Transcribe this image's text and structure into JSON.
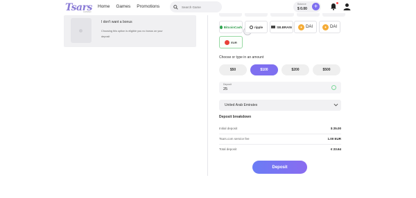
{
  "header": {
    "logo": "Tsars",
    "logo_sub": "CASINO",
    "nav": [
      "Home",
      "Games",
      "Promotions"
    ],
    "search_placeholder": "Search Game",
    "balance_label": "Balance",
    "balance_value": "$ 0.00"
  },
  "bonus": {
    "title": "I don't want a bonus",
    "description": "Choosing this option is eligible you no bonus on your deposit"
  },
  "payment_methods": [
    {
      "label": "BitcoinCash",
      "icon": "bitcoin-cash-icon"
    },
    {
      "label": "ripple",
      "icon": "ripple-icon"
    },
    {
      "label": "SB.BRAIN",
      "icon": "sb-icon"
    },
    {
      "label": "DAI",
      "icon": "dai-icon"
    },
    {
      "label": "DAI",
      "icon": "dai-icon"
    },
    {
      "label": "EUR",
      "icon": "eur-icon"
    }
  ],
  "amount": {
    "title": "Choose or type in an amount",
    "options": [
      "$50",
      "$100",
      "$200",
      "$500"
    ],
    "selected": "$100"
  },
  "deposit_input": {
    "label": "Deposit",
    "value": "25"
  },
  "country": {
    "value": "United Arab Emirates"
  },
  "breakdown": {
    "title": "Deposit breakdown",
    "rows": [
      {
        "label": "Initial deposit",
        "value": "$ 25.00"
      },
      {
        "label": "Tsars.com service fee",
        "value": "1.00 EUR"
      },
      {
        "label": "Total deposit",
        "value": "€ 23.64"
      }
    ]
  },
  "deposit_button": "Deposit",
  "colors": {
    "accent": "#7e6ff0",
    "success": "#7cd79a"
  }
}
